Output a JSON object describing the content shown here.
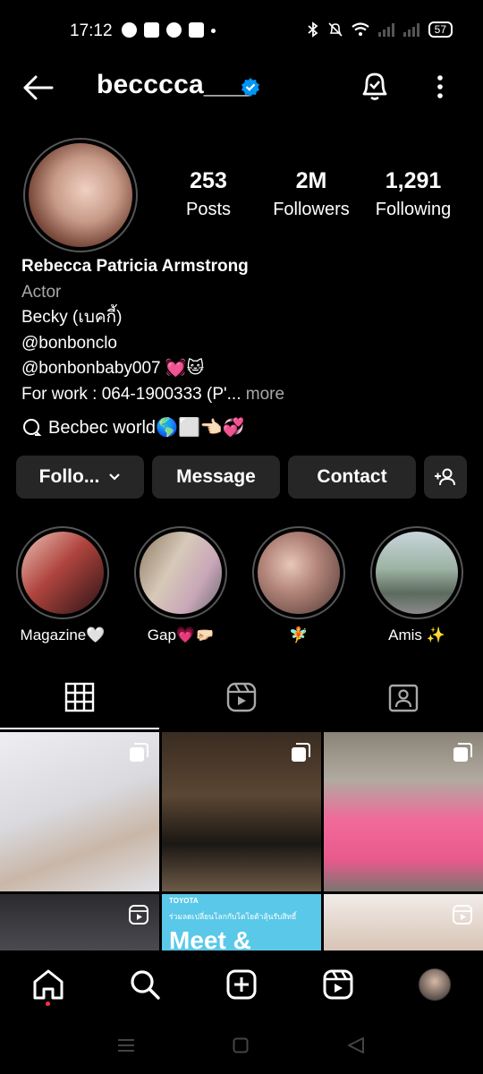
{
  "status_bar": {
    "time": "17:12",
    "battery": "57"
  },
  "header": {
    "username": "becccca___"
  },
  "stats": [
    {
      "value": "253",
      "label": "Posts"
    },
    {
      "value": "2M",
      "label": "Followers"
    },
    {
      "value": "1,291",
      "label": "Following"
    }
  ],
  "bio": {
    "name": "Rebecca Patricia Armstrong",
    "category": "Actor",
    "line1": "Becky (เบคกี้)",
    "line2": "@bonbonclo",
    "line3": "@bonbonbaby007 💓🐱",
    "line4": "For work : 064-1900333 (P'...",
    "more": "more"
  },
  "threads_label": "Becbec world🌎⬜👈🏻💞",
  "buttons": {
    "follow": "Follo...",
    "message": "Message",
    "contact": "Contact"
  },
  "highlights": [
    {
      "label": "Magazine🤍"
    },
    {
      "label": "Gap💗🤛🏻"
    },
    {
      "label": "🧚"
    },
    {
      "label": "Amis ✨"
    }
  ],
  "grid_banner": {
    "brand": "TOYOTA",
    "headline": "ร่วมลดเปลี่ยนโลกกับโตโยต้าลุ้นรับสิทธิ์",
    "big_text": "Meet &"
  },
  "colors": {
    "background": "#000000",
    "button_bg": "#262626",
    "verified": "#0095f6",
    "secondary_text": "#a8a8a8",
    "notification_dot": "#ff3040"
  }
}
